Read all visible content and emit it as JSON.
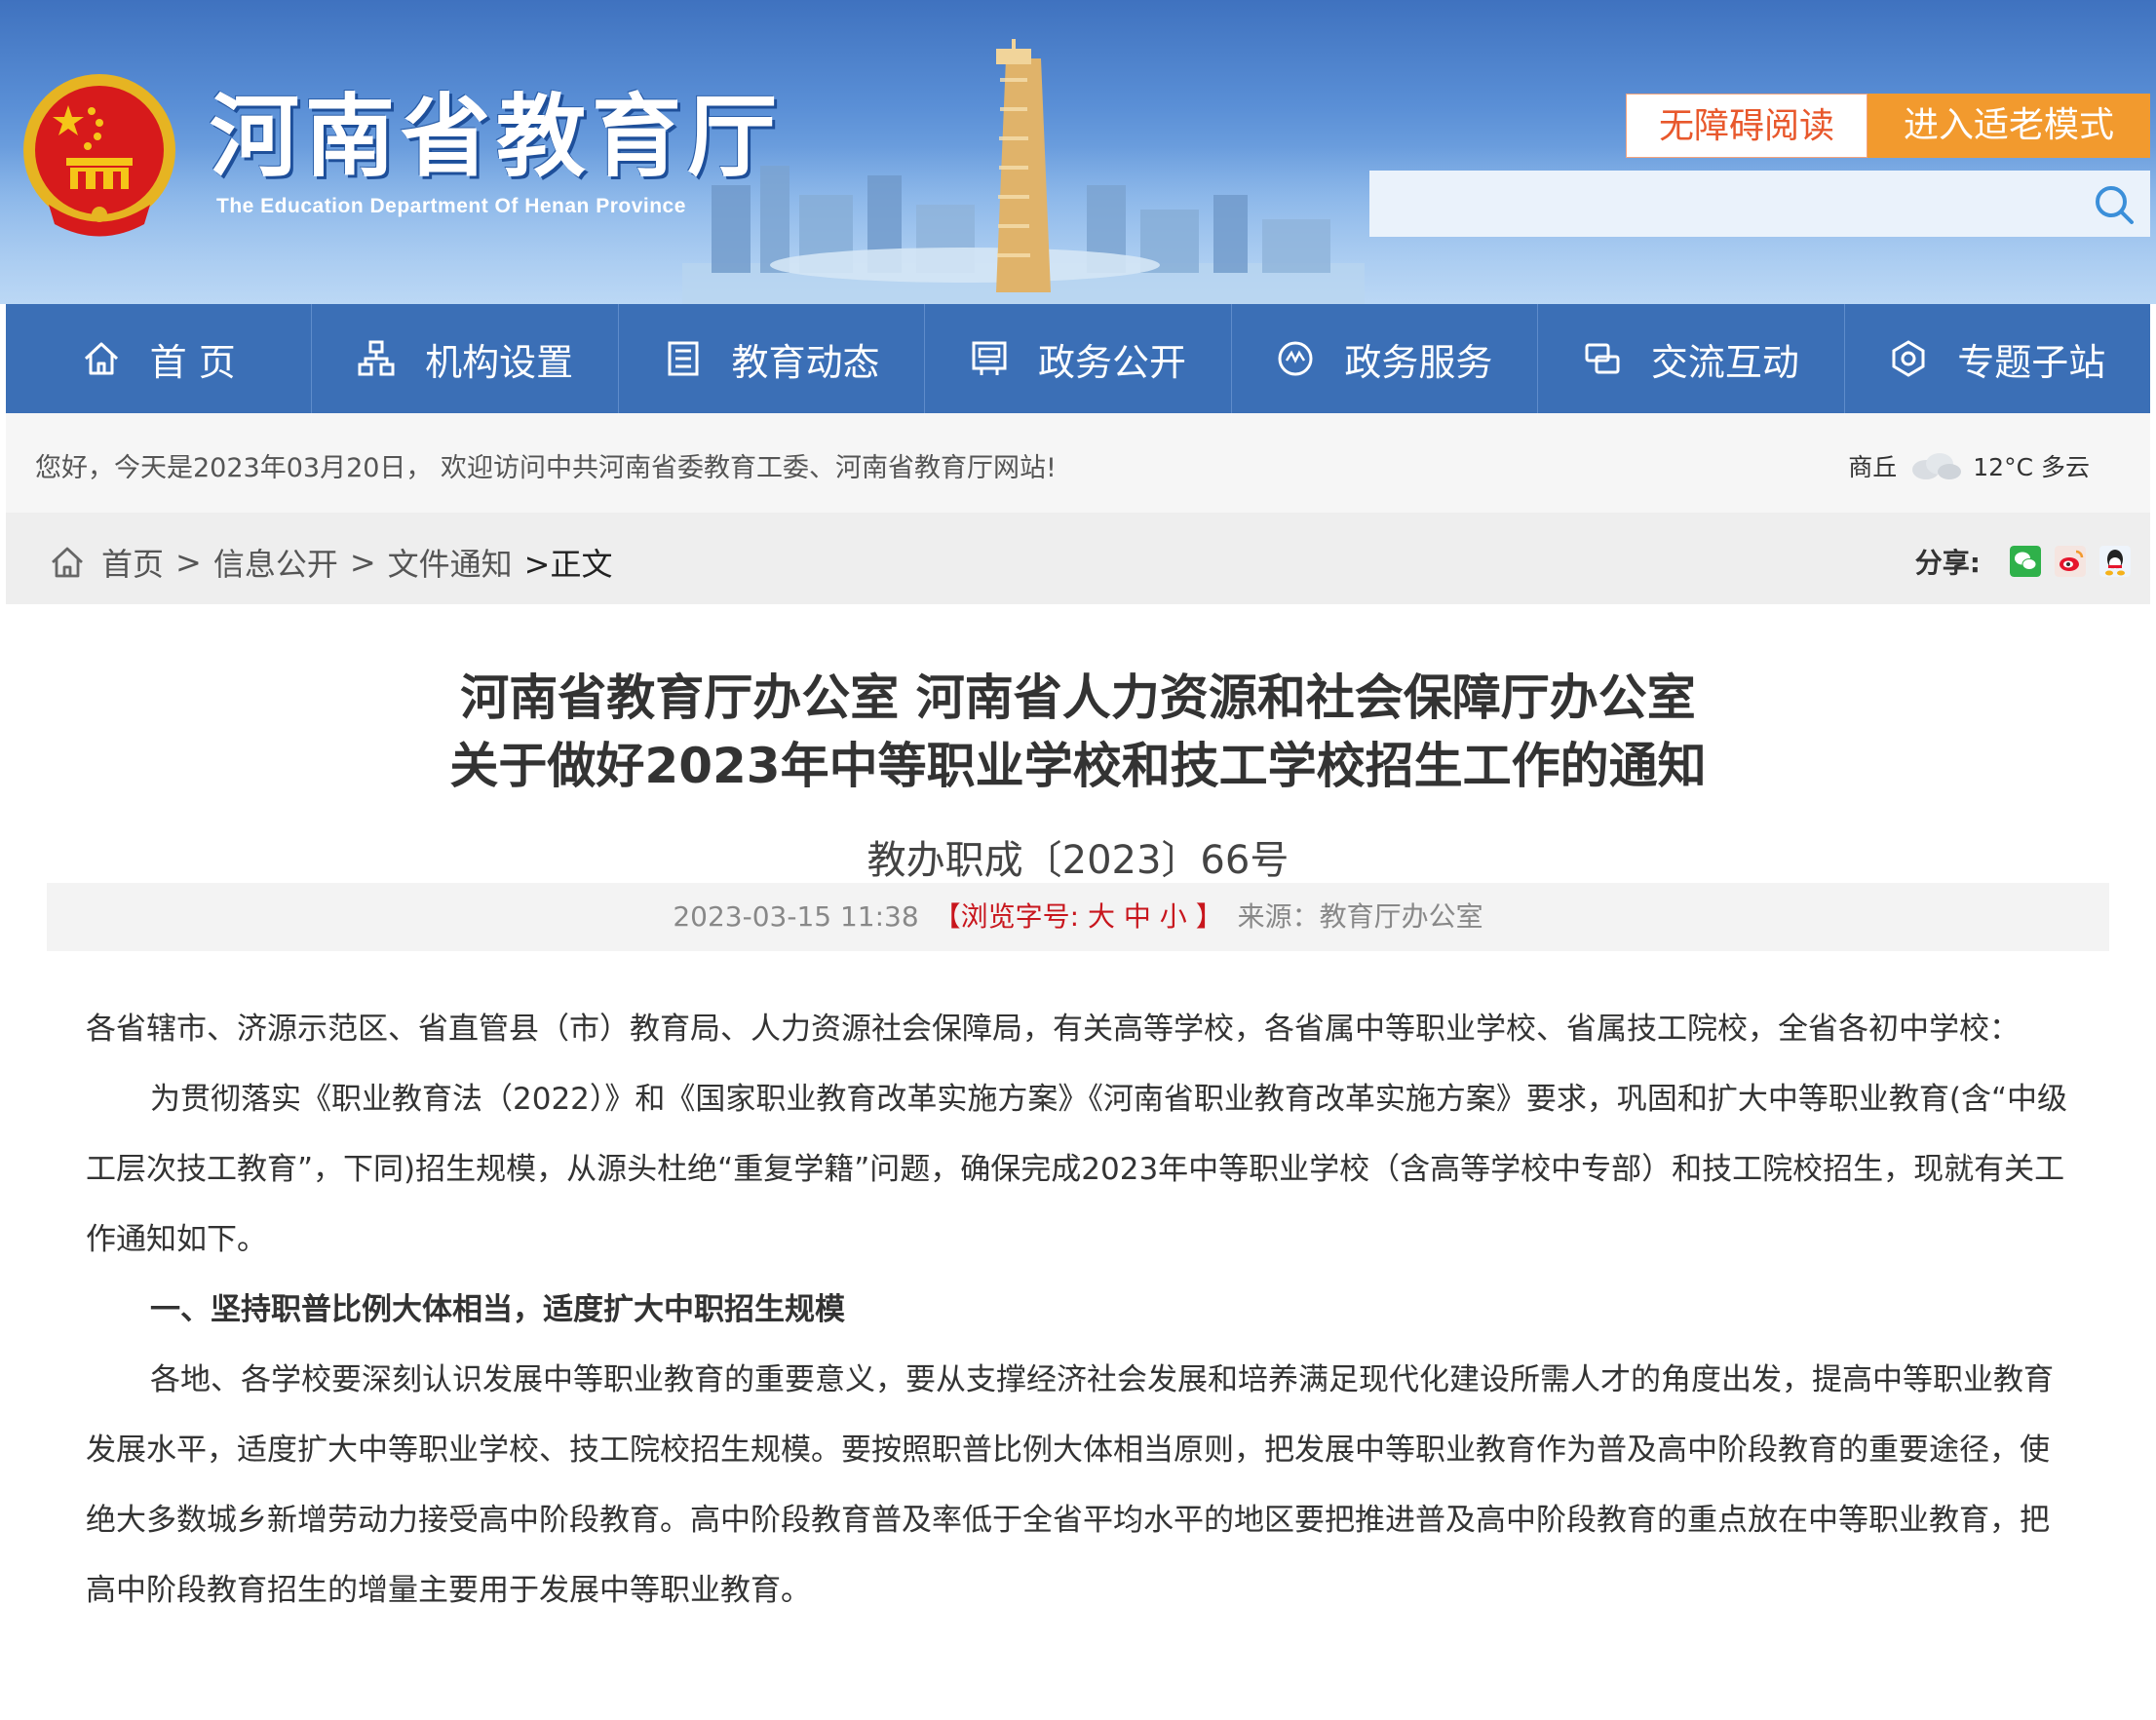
{
  "header": {
    "title": "河南省教育厅",
    "subtitle": "The Education Department Of Henan Province",
    "btn_accessible": "无障碍阅读",
    "btn_elder": "进入适老模式",
    "search_placeholder": ""
  },
  "nav": {
    "items": [
      {
        "label": "首 页",
        "icon": "home-icon"
      },
      {
        "label": "机构设置",
        "icon": "org-chart-icon"
      },
      {
        "label": "教育动态",
        "icon": "news-icon"
      },
      {
        "label": "政务公开",
        "icon": "notice-board-icon"
      },
      {
        "label": "政务服务",
        "icon": "service-icon"
      },
      {
        "label": "交流互动",
        "icon": "interaction-icon"
      },
      {
        "label": "专题子站",
        "icon": "subsite-icon"
      }
    ]
  },
  "welcome": {
    "text": "您好，今天是2023年03月20日， 欢迎访问中共河南省委教育工委、河南省教育厅网站!",
    "city": "商丘",
    "weather": "12°C 多云"
  },
  "breadcrumb": {
    "home": "首页",
    "sep": ">",
    "level1": "信息公开",
    "level2": "文件通知",
    "current": ">正文"
  },
  "share": {
    "label": "分享:",
    "icons": [
      "wechat-icon",
      "weibo-icon",
      "qq-icon"
    ]
  },
  "article": {
    "title_line1": "河南省教育厅办公室 河南省人力资源和社会保障厅办公室",
    "title_line2": "关于做好2023年中等职业学校和技工学校招生工作的通知",
    "doc_no": "教办职成〔2023〕66号",
    "date": "2023-03-15 11:38",
    "font_open": "【浏览字号:",
    "font_large": "大",
    "font_medium": "中",
    "font_small": "小",
    "font_close": "】",
    "source": "来源：教育厅办公室",
    "para1": "各省辖市、济源示范区、省直管县（市）教育局、人力资源社会保障局，有关高等学校，各省属中等职业学校、省属技工院校，全省各初中学校：",
    "para2": "为贯彻落实《职业教育法（2022）》和《国家职业教育改革实施方案》《河南省职业教育改革实施方案》要求，巩固和扩大中等职业教育(含“中级工层次技工教育”，下同)招生规模，从源头杜绝“重复学籍”问题，确保完成2023年中等职业学校（含高等学校中专部）和技工院校招生，现就有关工作通知如下。",
    "heading1": "一、坚持职普比例大体相当，适度扩大中职招生规模",
    "para3": "各地、各学校要深刻认识发展中等职业教育的重要意义，要从支撑经济社会发展和培养满足现代化建设所需人才的角度出发，提高中等职业教育发展水平，适度扩大中等职业学校、技工院校招生规模。要按照职普比例大体相当原则，把发展中等职业教育作为普及高中阶段教育的重要途径，使绝大多数城乡新增劳动力接受高中阶段教育。高中阶段教育普及率低于全省平均水平的地区要把推进普及高中阶段教育的重点放在中等职业教育，把高中阶段教育招生的增量主要用于发展中等职业教育。"
  }
}
